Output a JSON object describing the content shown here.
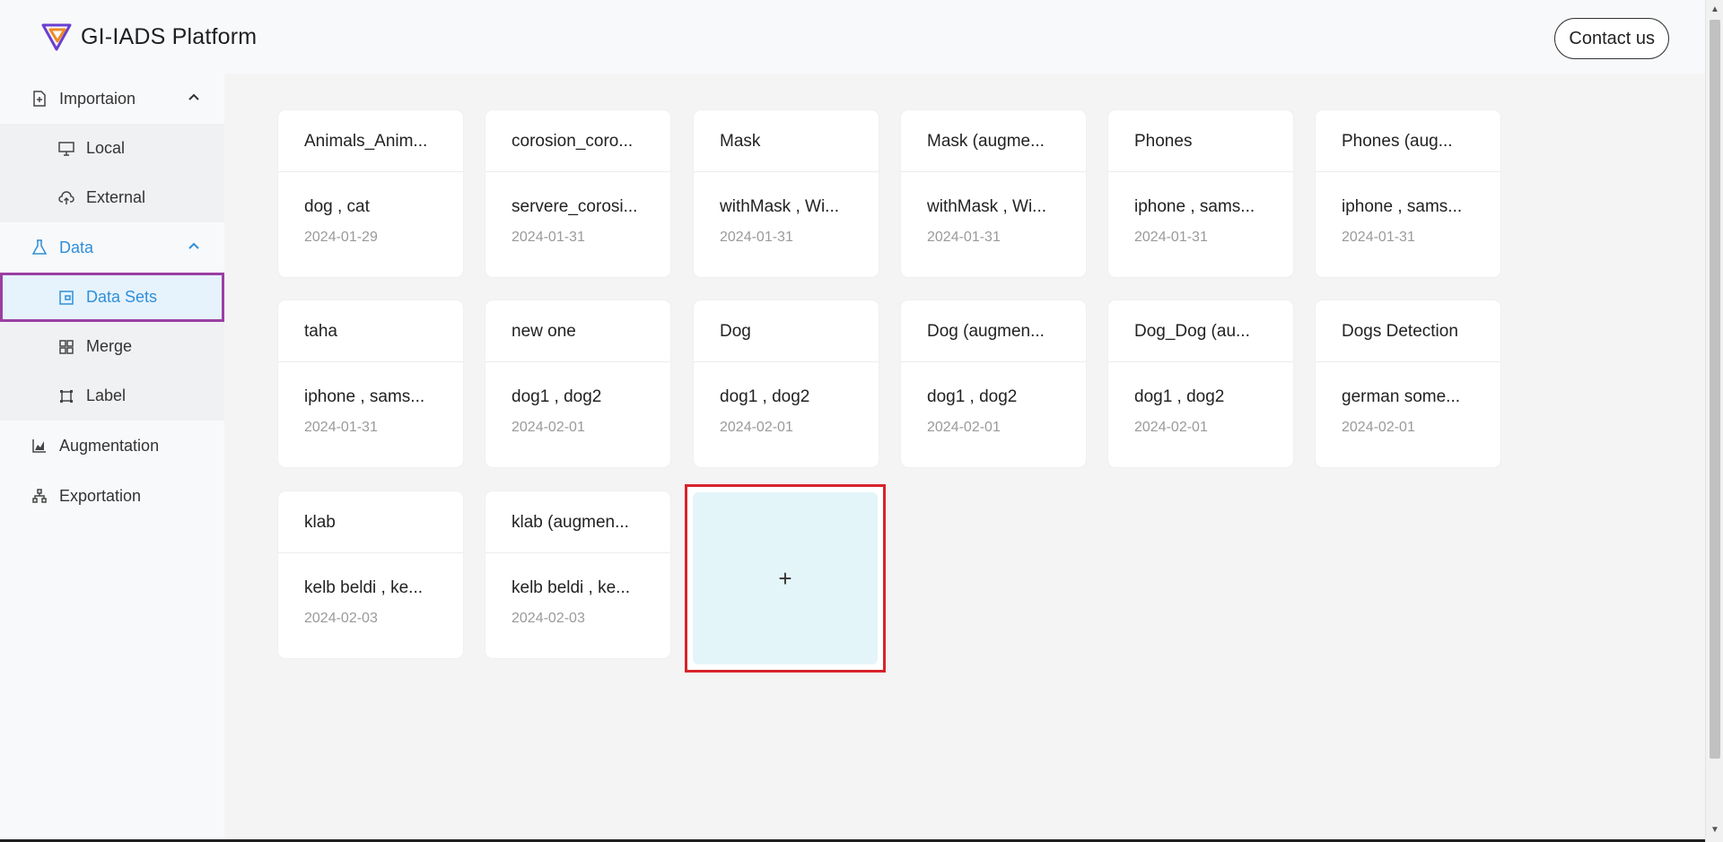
{
  "header": {
    "app_title": "GI-IADS Platform",
    "contact_label": "Contact us"
  },
  "sidebar": {
    "groups": [
      {
        "label": "Importaion",
        "icon": "file-import-icon",
        "expanded": true,
        "items": [
          {
            "label": "Local",
            "icon": "monitor-icon"
          },
          {
            "label": "External",
            "icon": "cloud-upload-icon"
          }
        ]
      },
      {
        "label": "Data",
        "icon": "flask-icon",
        "expanded": true,
        "active": true,
        "items": [
          {
            "label": "Data Sets",
            "icon": "wallet-icon",
            "selected": true
          },
          {
            "label": "Merge",
            "icon": "merge-icon"
          },
          {
            "label": "Label",
            "icon": "label-icon"
          }
        ]
      },
      {
        "label": "Augmentation",
        "icon": "area-chart-icon"
      },
      {
        "label": "Exportation",
        "icon": "cluster-icon"
      }
    ]
  },
  "datasets": [
    {
      "title": "Animals_Anim...",
      "labels": "dog , cat",
      "date": "2024-01-29"
    },
    {
      "title": "corosion_coro...",
      "labels": "servere_corosi...",
      "date": "2024-01-31"
    },
    {
      "title": "Mask",
      "labels": "withMask , Wi...",
      "date": "2024-01-31"
    },
    {
      "title": "Mask (augme...",
      "labels": "withMask , Wi...",
      "date": "2024-01-31"
    },
    {
      "title": "Phones",
      "labels": "iphone , sams...",
      "date": "2024-01-31"
    },
    {
      "title": "Phones (aug...",
      "labels": "iphone , sams...",
      "date": "2024-01-31"
    },
    {
      "title": "taha",
      "labels": "iphone , sams...",
      "date": "2024-01-31"
    },
    {
      "title": "new one",
      "labels": "dog1 , dog2",
      "date": "2024-02-01"
    },
    {
      "title": "Dog",
      "labels": "dog1 , dog2",
      "date": "2024-02-01"
    },
    {
      "title": "Dog (augmen...",
      "labels": "dog1 , dog2",
      "date": "2024-02-01"
    },
    {
      "title": "Dog_Dog (au...",
      "labels": "dog1 , dog2",
      "date": "2024-02-01"
    },
    {
      "title": "Dogs Detection",
      "labels": "german some...",
      "date": "2024-02-01"
    },
    {
      "title": "klab",
      "labels": "kelb beldi , ke...",
      "date": "2024-02-03"
    },
    {
      "title": "klab (augmen...",
      "labels": "kelb beldi , ke...",
      "date": "2024-02-03"
    }
  ],
  "add_card": {
    "symbol": "+"
  },
  "colors": {
    "accent": "#2f8fd8",
    "selected_outline": "#9b3fa3",
    "add_outline": "#d8232a",
    "add_bg": "#e4f5fa"
  }
}
